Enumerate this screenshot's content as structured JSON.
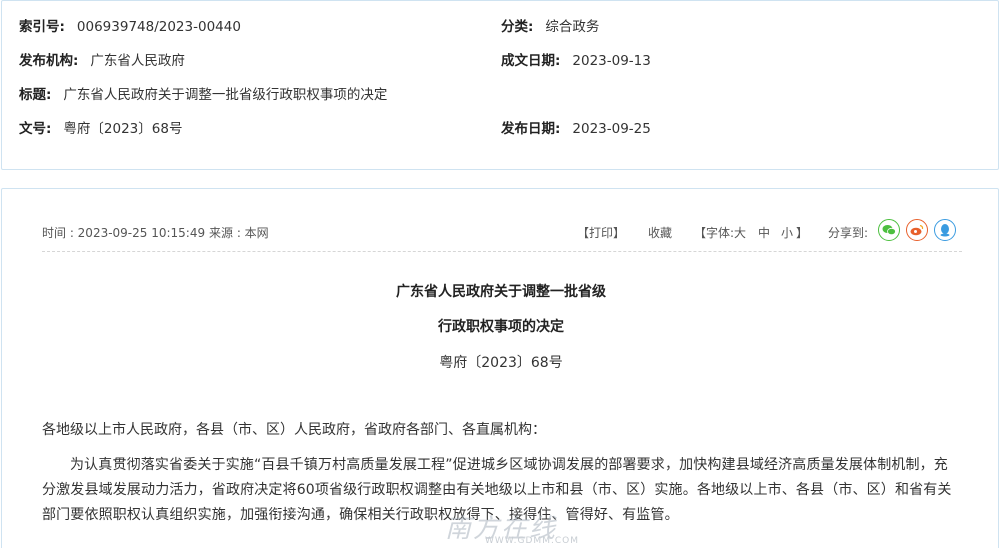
{
  "meta": {
    "index_label": "索引号:",
    "index_value": "006939748/2023-00440",
    "category_label": "分类:",
    "category_value": "综合政务",
    "publisher_label": "发布机构:",
    "publisher_value": "广东省人民政府",
    "written_date_label": "成文日期:",
    "written_date_value": "2023-09-13",
    "title_label": "标题:",
    "title_value": "广东省人民政府关于调整一批省级行政职权事项的决定",
    "doc_no_label": "文号:",
    "doc_no_value": "粤府〔2023〕68号",
    "publish_date_label": "发布日期:",
    "publish_date_value": "2023-09-25"
  },
  "infobar": {
    "time": "时间 : 2023-09-25 10:15:49",
    "source": "来源 : 本网",
    "print": "【打印】",
    "favorite": "收藏",
    "font_open": "【字体:",
    "font_large": "大",
    "font_medium": "中",
    "font_small": "小",
    "font_close": "】",
    "share_label": "分享到:",
    "share_icons": [
      "wechat-icon",
      "weibo-icon",
      "qq-icon"
    ],
    "share_colors": [
      "#4cbf3f",
      "#e8602c",
      "#3a9be0"
    ]
  },
  "article": {
    "title_line1": "广东省人民政府关于调整一批省级",
    "title_line2": "行政职权事项的决定",
    "doc_no": "粤府〔2023〕68号",
    "salutation": "各地级以上市人民政府，各县（市、区）人民政府，省政府各部门、各直属机构：",
    "body": "为认真贯彻落实省委关于实施“百县千镇万村高质量发展工程”促进城乡区域协调发展的部署要求，加快构建县域经济高质量发展体制机制，充分激发县域发展动力活力，省政府决定将60项省级行政职权调整由有关地级以上市和县（市、区）实施。各地级以上市、各县（市、区）和省有关部门要依照职权认真组织实施，加强衔接沟通，确保相关行政职权放得下、接得住、管得好、有监管。"
  },
  "watermark": {
    "text": "南方在线",
    "url": "WWW.GDMM.COM"
  }
}
